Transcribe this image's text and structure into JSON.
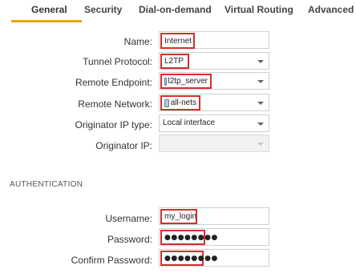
{
  "tabs": [
    {
      "label": "General",
      "active": true
    },
    {
      "label": "Security"
    },
    {
      "label": "Dial-on-demand"
    },
    {
      "label": "Virtual Routing"
    },
    {
      "label": "Advanced"
    }
  ],
  "general": {
    "name": {
      "label": "Name:",
      "value": "Internet"
    },
    "tunnel_protocol": {
      "label": "Tunnel Protocol:",
      "value": "L2TP"
    },
    "remote_endpoint": {
      "label": "Remote Endpoint:",
      "value": "l2tp_server",
      "icon": "network-object-icon"
    },
    "remote_network": {
      "label": "Remote Network:",
      "value": "all-nets",
      "icon": "network-object-icon"
    },
    "originator_ip_type": {
      "label": "Originator IP type:",
      "value": "Local interface"
    },
    "originator_ip": {
      "label": "Originator IP:",
      "value": ""
    }
  },
  "authentication": {
    "heading": "AUTHENTICATION",
    "username": {
      "label": "Username:",
      "value": "my_login"
    },
    "password": {
      "label": "Password:",
      "value": "●●●●●●●●"
    },
    "confirm_password": {
      "label": "Confirm Password:",
      "value": "●●●●●●●●"
    }
  },
  "colors": {
    "highlight": "#d32f2f",
    "active_tab_underline": "#f0a30a"
  }
}
